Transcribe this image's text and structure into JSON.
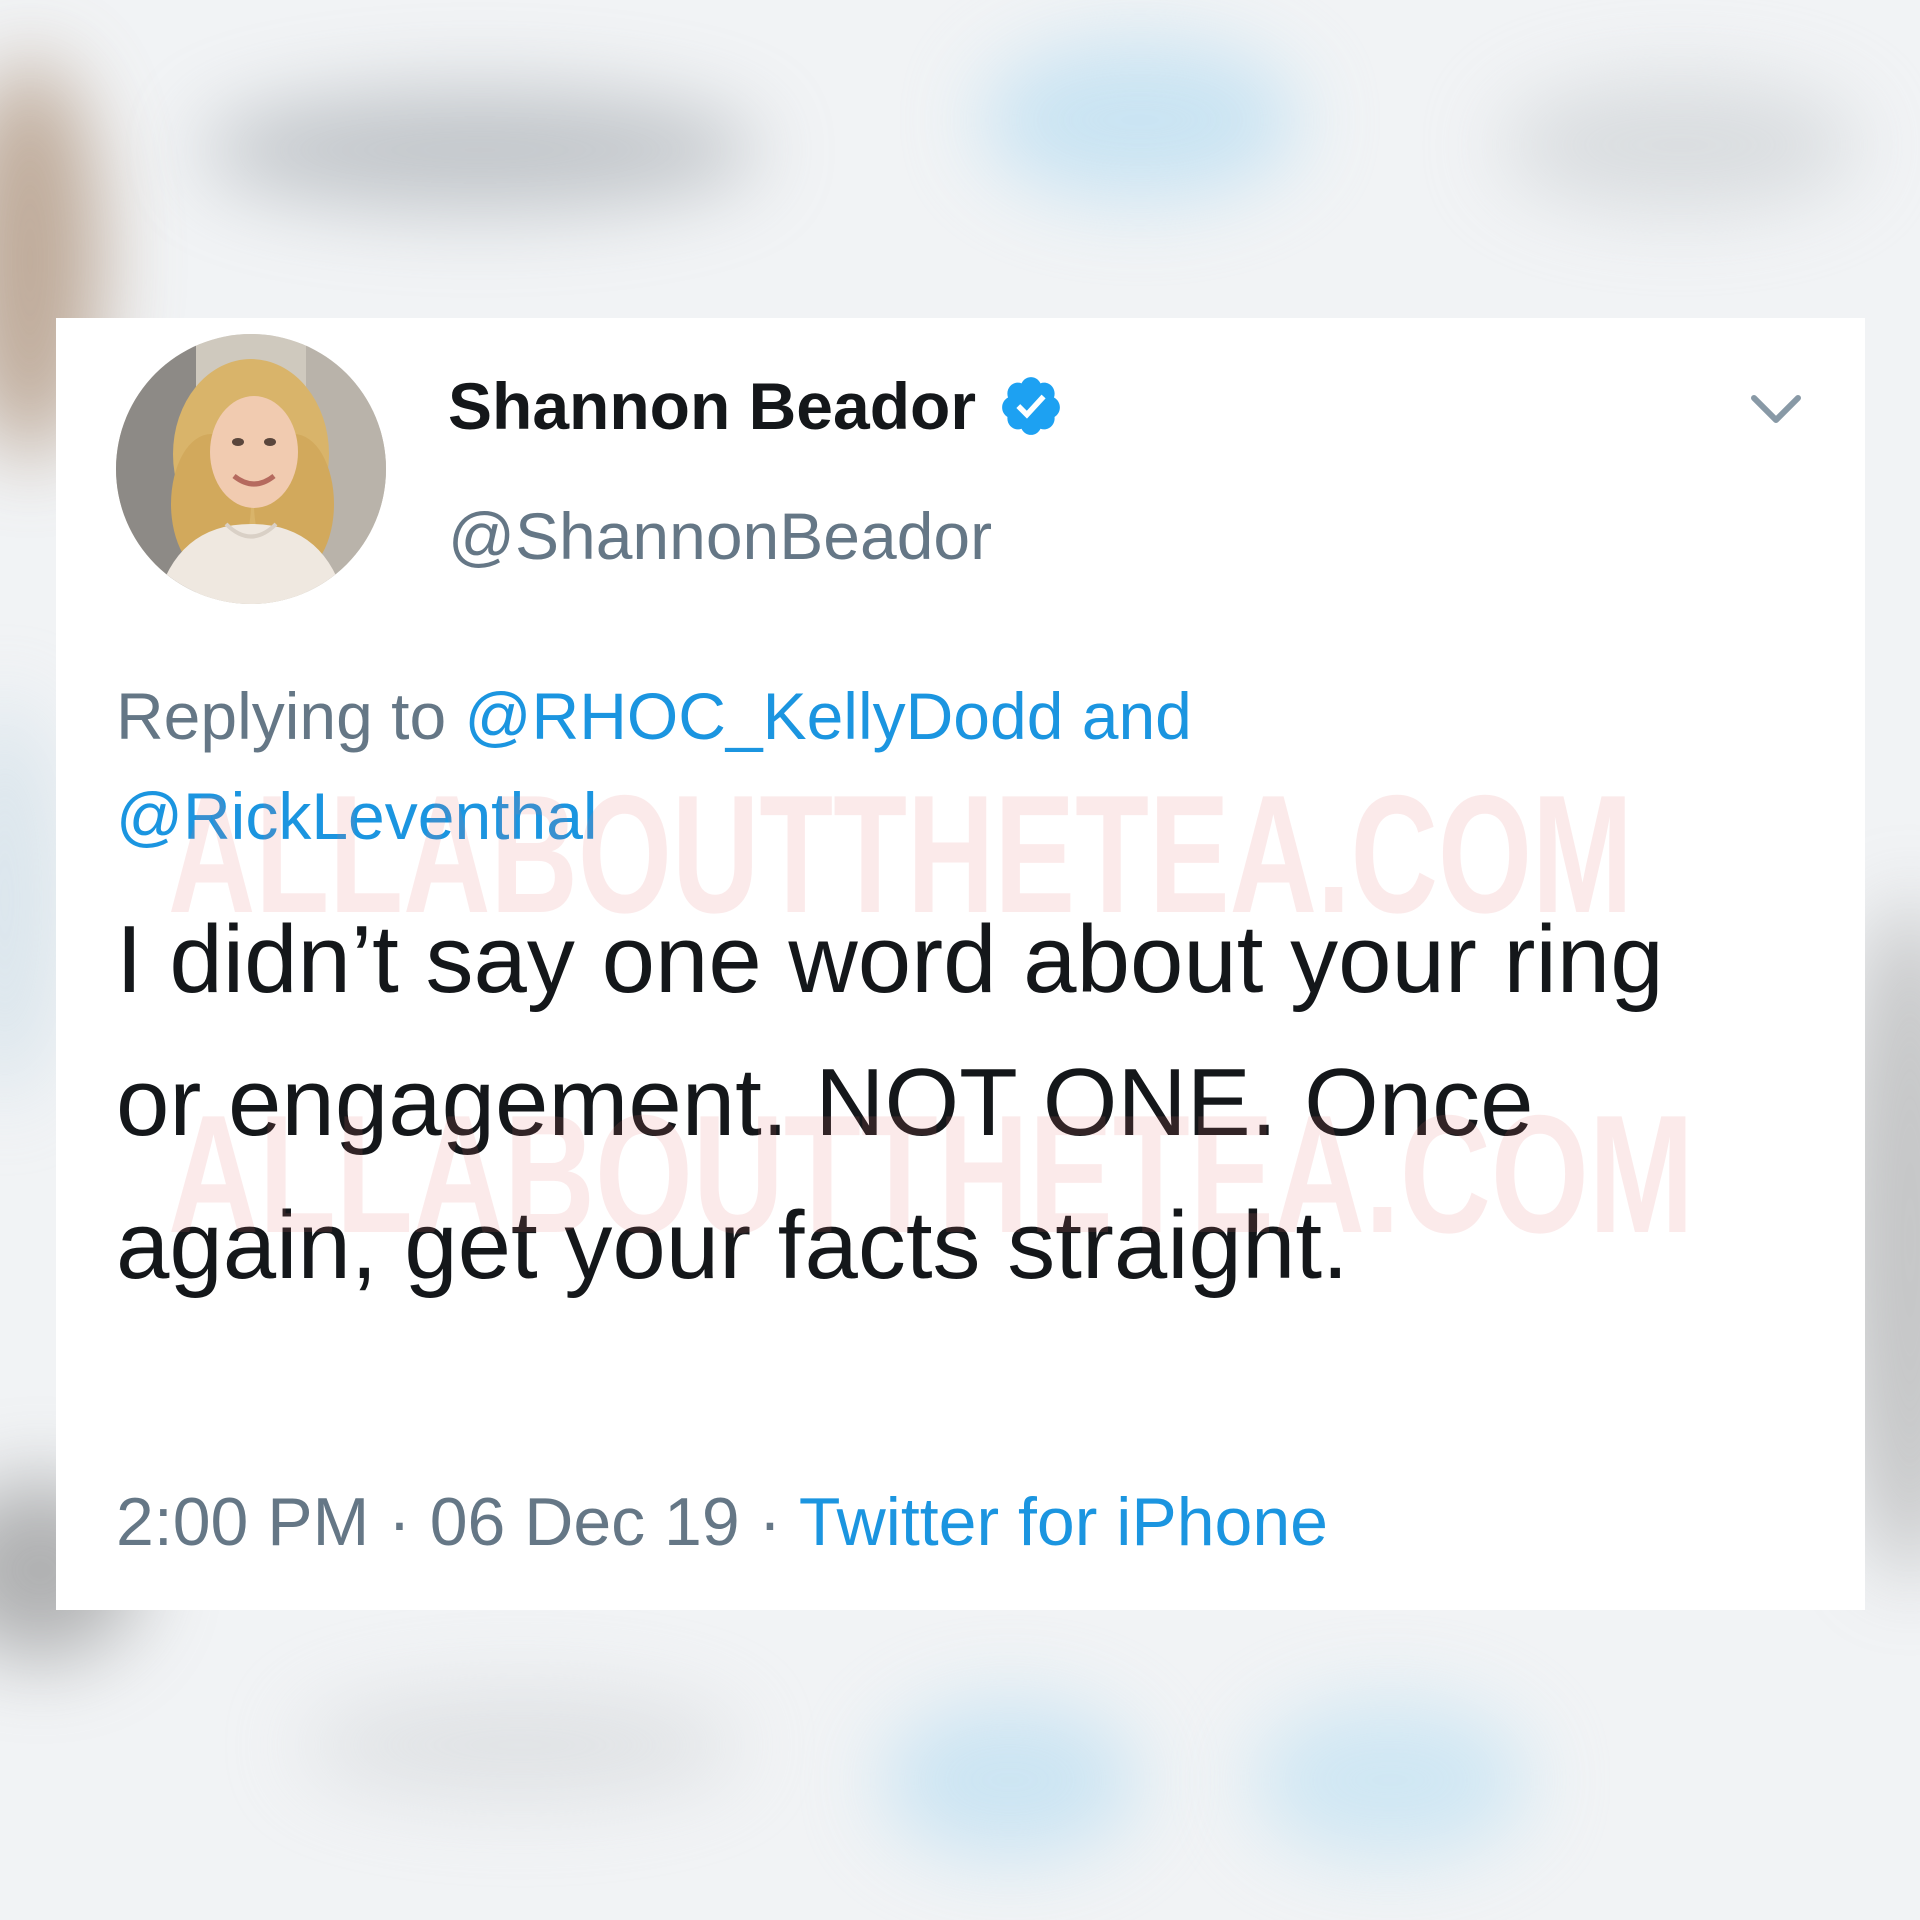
{
  "tweet": {
    "display_name": "Shannon Beador",
    "handle": "@ShannonBeador",
    "replying_prefix": "Replying to ",
    "reply_mention_1": "@RHOC_KellyDodd",
    "reply_and": " and",
    "reply_mention_2": "@RickLeventhal",
    "text": "I didn’t say one word about your ring or engagement. NOT ONE. Once again, get your facts straight.",
    "time": "2:00 PM",
    "separator": " · ",
    "date": "06 Dec 19",
    "source": "Twitter for iPhone"
  },
  "watermark": {
    "text": "ALLABOUTTHETEA.COM"
  },
  "icons": {
    "verified": "verified-badge-icon",
    "chevron": "chevron-down-icon"
  },
  "colors": {
    "link": "#1b95e0",
    "muted": "#657786",
    "text": "#14171a",
    "verified": "#1da1f2",
    "watermark": "#e57373"
  }
}
